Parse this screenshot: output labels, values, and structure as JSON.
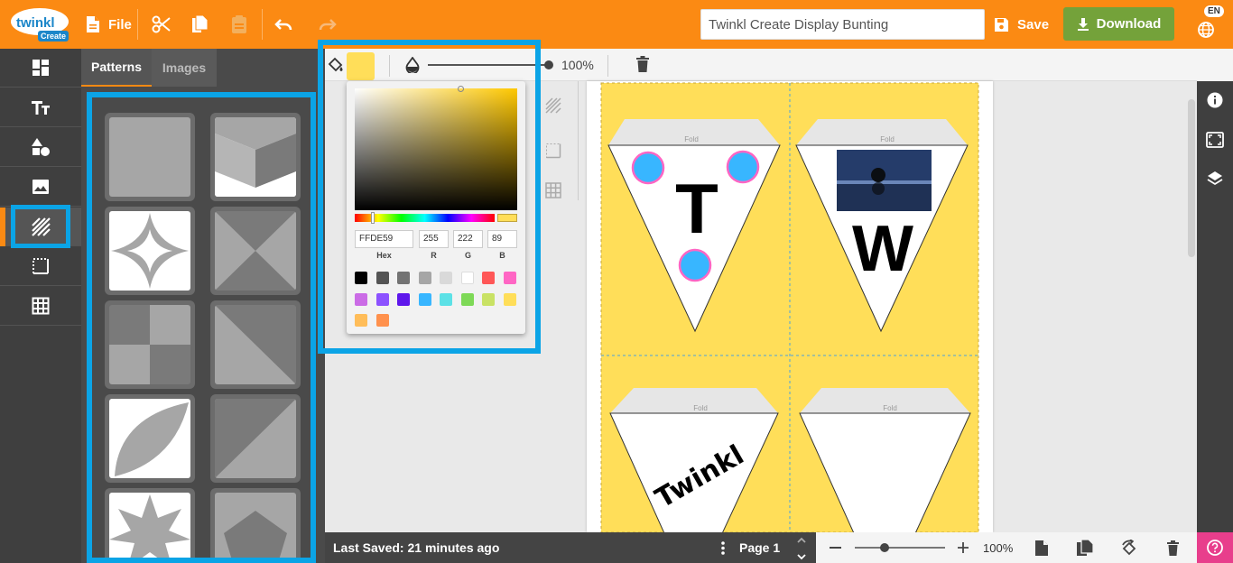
{
  "brand": {
    "logo_text": "twinkl",
    "logo_sub": "Create"
  },
  "topbar": {
    "file_label": "File",
    "document_title": "Twinkl Create Display Bunting",
    "save_label": "Save",
    "download_label": "Download",
    "language": "EN",
    "accent_color": "#fb8a13"
  },
  "panel": {
    "tabs": [
      {
        "label": "Patterns",
        "active": true
      },
      {
        "label": "Images",
        "active": false
      }
    ]
  },
  "toolbar": {
    "opacity": "100%",
    "fill_color": "#FFDE59"
  },
  "color_picker": {
    "hex_value": "FFDE59",
    "r_value": "255",
    "g_value": "222",
    "b_value": "89",
    "hex_label": "Hex",
    "r_label": "R",
    "g_label": "G",
    "b_label": "B",
    "swatches": [
      "#000000",
      "#545454",
      "#737373",
      "#a6a6a6",
      "#d9d9d9",
      "#ffffff",
      "#ff5757",
      "#ff66c4",
      "#cb6ce6",
      "#8c52ff",
      "#5e17eb",
      "#38b6ff",
      "#5ce1e6",
      "#7ed957",
      "#c9e265",
      "#ffde59",
      "#ffbd59",
      "#ff914d"
    ]
  },
  "canvas": {
    "fold_label": "Fold",
    "flags": [
      {
        "letter": "T"
      },
      {
        "letter": "W"
      },
      {
        "letter": "Twinkl"
      },
      {
        "letter": ""
      }
    ]
  },
  "statusbar": {
    "last_saved": "Last Saved: 21 minutes ago",
    "page_label": "Page 1",
    "zoom": "100%"
  }
}
